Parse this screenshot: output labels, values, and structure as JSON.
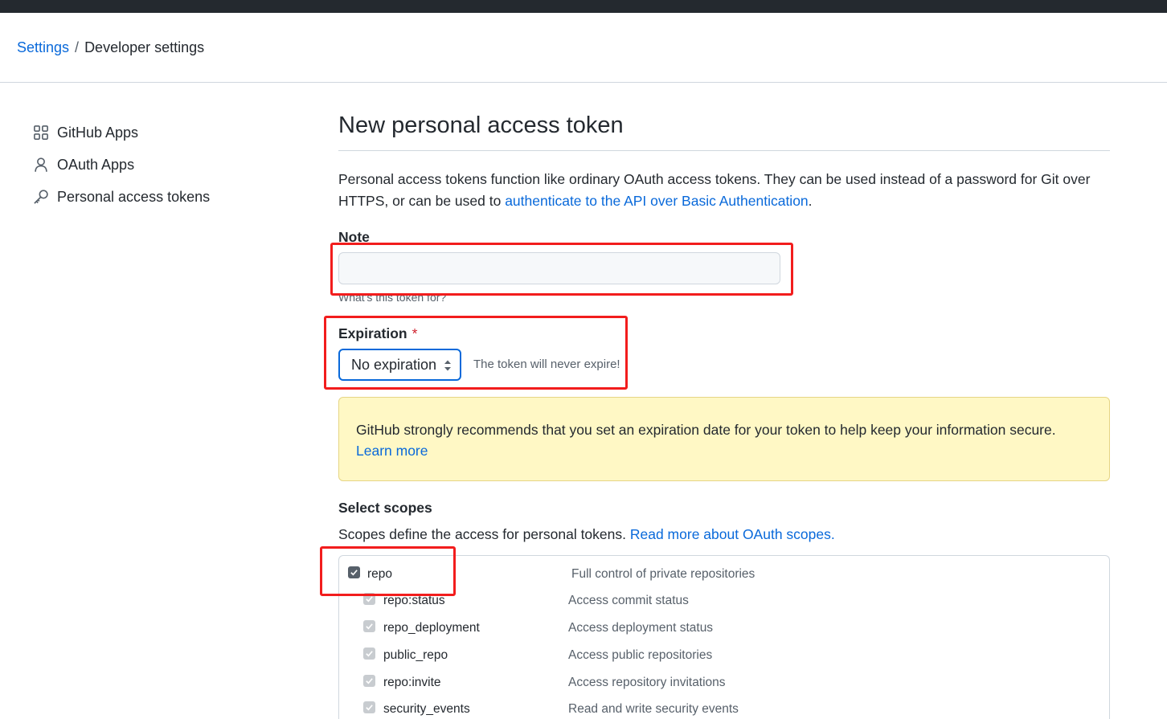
{
  "breadcrumb": {
    "settings": "Settings",
    "separator": "/",
    "current": "Developer settings"
  },
  "sidebar": {
    "items": [
      {
        "label": "GitHub Apps",
        "icon": "apps-icon"
      },
      {
        "label": "OAuth Apps",
        "icon": "person-icon"
      },
      {
        "label": "Personal access tokens",
        "icon": "key-icon"
      }
    ]
  },
  "main": {
    "title": "New personal access token",
    "intro_text": "Personal access tokens function like ordinary OAuth access tokens. They can be used instead of a password for Git over HTTPS, or can be used to ",
    "intro_link": "authenticate to the API over Basic Authentication",
    "intro_end": ".",
    "note": {
      "label": "Note",
      "value": "",
      "hint": "What's this token for?"
    },
    "expiration": {
      "label": "Expiration",
      "required_mark": "*",
      "selected": "No expiration",
      "hint": "The token will never expire!"
    },
    "warning": {
      "text": "GitHub strongly recommends that you set an expiration date for your token to help keep your information secure.",
      "link": "Learn more"
    },
    "scopes": {
      "title": "Select scopes",
      "desc": "Scopes define the access for personal tokens. ",
      "desc_link": "Read more about OAuth scopes.",
      "items": [
        {
          "name": "repo",
          "desc": "Full control of private repositories",
          "checked": true
        },
        {
          "name": "repo:status",
          "desc": "Access commit status",
          "checked": true
        },
        {
          "name": "repo_deployment",
          "desc": "Access deployment status",
          "checked": true
        },
        {
          "name": "public_repo",
          "desc": "Access public repositories",
          "checked": true
        },
        {
          "name": "repo:invite",
          "desc": "Access repository invitations",
          "checked": true
        },
        {
          "name": "security_events",
          "desc": "Read and write security events",
          "checked": true
        }
      ]
    }
  },
  "colors": {
    "link": "#0969da",
    "highlight": "#f21d1d",
    "warning_bg": "#fff8c5"
  }
}
